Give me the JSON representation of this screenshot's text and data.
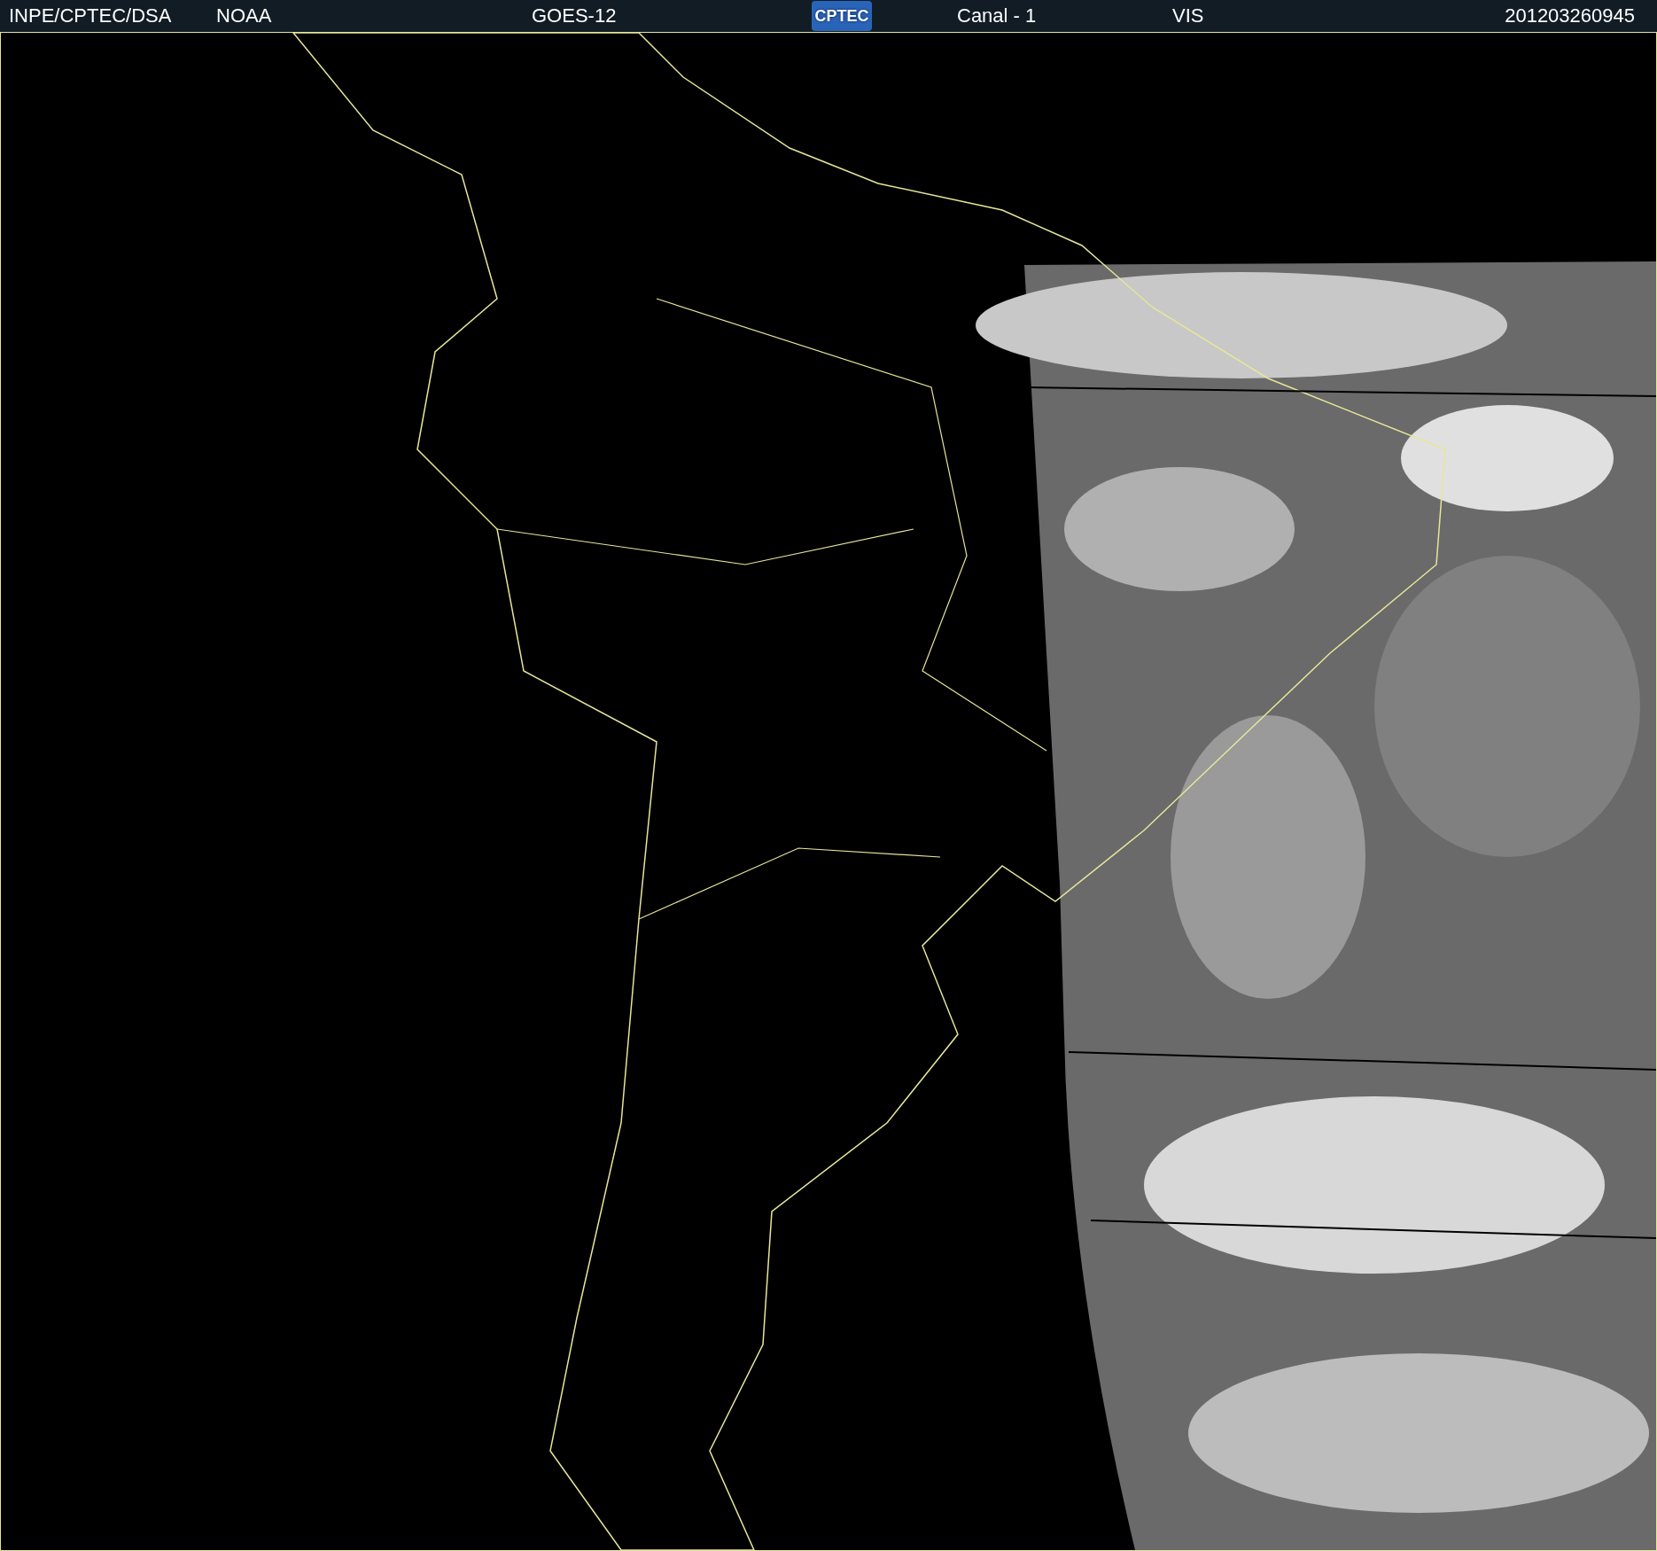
{
  "header": {
    "agency": "INPE/CPTEC/DSA",
    "source": "NOAA",
    "satellite": "GOES-12",
    "logo": "CPTEC",
    "channel": "Canal - 1",
    "band": "VIS",
    "timestamp": "201203260945"
  }
}
